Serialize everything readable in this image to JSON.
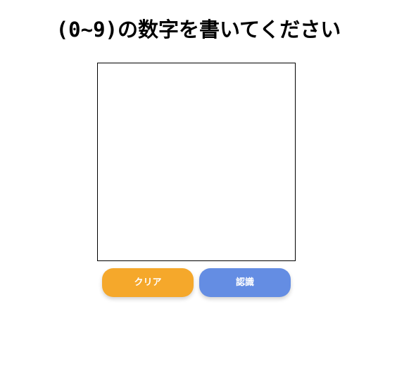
{
  "header": {
    "title_prefix": "(0~9)",
    "title_main": "の数字を書いてください"
  },
  "canvas": {
    "border_color": "#000000",
    "background": "#ffffff"
  },
  "buttons": {
    "clear_label": "クリア",
    "clear_color": "#f5a82b",
    "recognize_label": "認識",
    "recognize_color": "#648de3"
  }
}
